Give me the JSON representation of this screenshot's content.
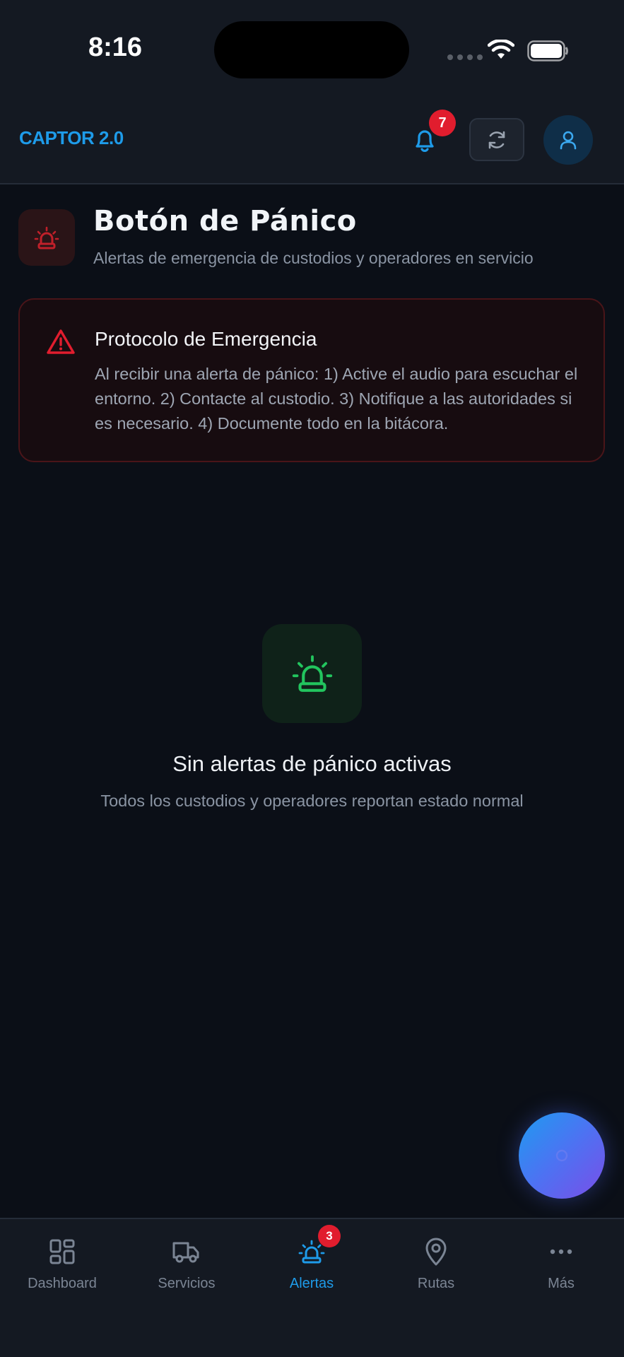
{
  "status_bar": {
    "time": "8:16",
    "icons": [
      "signal-icon",
      "wifi-icon",
      "battery-icon"
    ]
  },
  "header": {
    "brand": "CAPTOR 2.0",
    "notifications_count": "7",
    "icons": [
      "bell-icon",
      "refresh-icon",
      "user-icon"
    ]
  },
  "page": {
    "title": "Botón de Pánico",
    "subtitle": "Alertas de emergencia de custodios y operadores en servicio",
    "icon": "siren-icon"
  },
  "protocol": {
    "title": "Protocolo de Emergencia",
    "text": "Al recibir una alerta de pánico: 1) Active el audio para escuchar el entorno. 2) Contacte al custodio. 3) Notifique a las autoridades si es necesario. 4) Documente todo en la bitácora.",
    "icon": "warning-triangle-icon"
  },
  "empty_state": {
    "title": "Sin alertas de pánico activas",
    "subtitle": "Todos los custodios y operadores reportan estado normal",
    "icon": "siren-icon"
  },
  "bottom_nav": {
    "items": [
      {
        "label": "Dashboard",
        "icon": "dashboard-grid-icon",
        "active": false
      },
      {
        "label": "Servicios",
        "icon": "truck-icon",
        "active": false
      },
      {
        "label": "Alertas",
        "icon": "siren-icon",
        "active": true,
        "badge": "3"
      },
      {
        "label": "Rutas",
        "icon": "map-pin-icon",
        "active": false
      },
      {
        "label": "Más",
        "icon": "more-dots-icon",
        "active": false
      }
    ]
  },
  "colors": {
    "accent": "#1e9be9",
    "danger": "#e11d2e",
    "success": "#22c55e",
    "background": "#0b0f17",
    "surface": "#141922"
  }
}
